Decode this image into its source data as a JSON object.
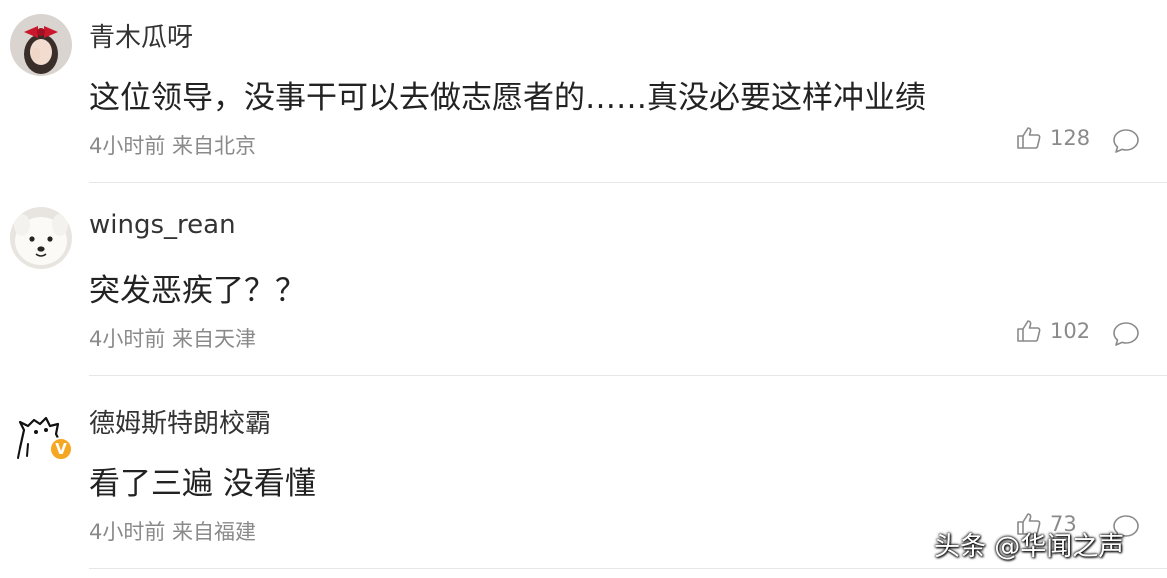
{
  "comments": [
    {
      "username": "青木瓜呀",
      "content": "这位领导，没事干可以去做志愿者的……真没必要这样冲业绩",
      "meta": "4小时前 来自北京",
      "likes": "128",
      "avatar_icon": "girl-with-red-bow-avatar",
      "verified": false
    },
    {
      "username": "wings_rean",
      "content": "突发恶疾了？？",
      "meta": "4小时前 来自天津",
      "likes": "102",
      "avatar_icon": "white-dog-avatar",
      "verified": false
    },
    {
      "username": "德姆斯特朗校霸",
      "content": "看了三遍 没看懂",
      "meta": "4小时前 来自福建",
      "likes": "73",
      "avatar_icon": "sketch-dog-avatar",
      "verified": true
    }
  ],
  "verified_badge": "V",
  "watermark": "头条 @华闻之声",
  "icons": {
    "like": "thumbs-up-icon",
    "reply": "comment-bubble-icon"
  },
  "colors": {
    "text_primary": "#222222",
    "text_meta": "#8a8a8a",
    "divider": "#e6e6e6",
    "verified_badge": "#f5a623"
  }
}
